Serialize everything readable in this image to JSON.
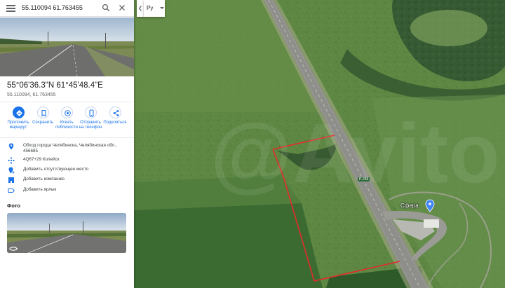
{
  "search": {
    "query": "55.110094 61.763455"
  },
  "place": {
    "dms_coordinates": "55°06'36.3\"N 61°45'48.4\"E",
    "decimal_coordinates": "55.110094, 61.763455"
  },
  "actions": [
    {
      "label_1": "Проложить",
      "label_2": "маршрут",
      "icon": "directions-icon"
    },
    {
      "label_1": "Сохранить",
      "label_2": "",
      "icon": "bookmark-icon"
    },
    {
      "label_1": "Искать",
      "label_2": "поблизости",
      "icon": "nearby-icon"
    },
    {
      "label_1": "Отправить",
      "label_2": "на телефон",
      "icon": "phone-icon"
    },
    {
      "label_1": "Поделиться",
      "label_2": "",
      "icon": "share-icon"
    }
  ],
  "info": {
    "address_line1": "Обход города Челябинска, Челябинская обл.,",
    "address_line2": "456685",
    "plus_code": "4Q67+29 Колейск",
    "add_missing_place": "Добавить отсутствующее место",
    "add_business": "Добавить компанию",
    "add_label": "Добавить ярлык"
  },
  "photos": {
    "heading": "Фото"
  },
  "map_controls": {
    "language": "Ру"
  },
  "map_labels": {
    "place_name": "Сфера",
    "road_shield": "P-255"
  },
  "colors": {
    "accent": "#1a73e8",
    "plot_outline": "#e52b2b"
  }
}
